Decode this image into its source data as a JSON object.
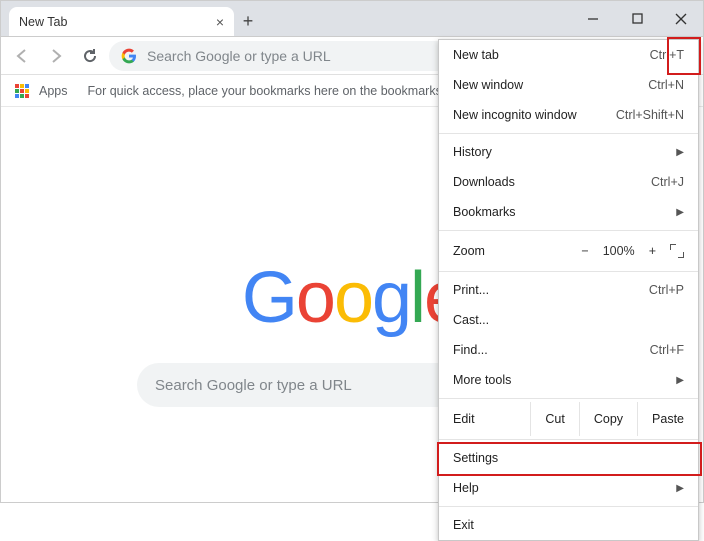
{
  "tab": {
    "title": "New Tab"
  },
  "omnibox": {
    "placeholder": "Search Google or type a URL"
  },
  "bookmarks_bar": {
    "apps_label": "Apps",
    "hint": "For quick access, place your bookmarks here on the bookmarks ba"
  },
  "content": {
    "logo_letters": [
      "G",
      "o",
      "o",
      "g",
      "l",
      "e"
    ],
    "search_placeholder": "Search Google or type a URL"
  },
  "menu": {
    "new_tab": {
      "label": "New tab",
      "shortcut": "Ctrl+T"
    },
    "new_window": {
      "label": "New window",
      "shortcut": "Ctrl+N"
    },
    "new_incognito": {
      "label": "New incognito window",
      "shortcut": "Ctrl+Shift+N"
    },
    "history": {
      "label": "History"
    },
    "downloads": {
      "label": "Downloads",
      "shortcut": "Ctrl+J"
    },
    "bookmarks": {
      "label": "Bookmarks"
    },
    "zoom": {
      "label": "Zoom",
      "value": "100%"
    },
    "print": {
      "label": "Print...",
      "shortcut": "Ctrl+P"
    },
    "cast": {
      "label": "Cast..."
    },
    "find": {
      "label": "Find...",
      "shortcut": "Ctrl+F"
    },
    "more_tools": {
      "label": "More tools"
    },
    "edit": {
      "label": "Edit",
      "cut": "Cut",
      "copy": "Copy",
      "paste": "Paste"
    },
    "settings": {
      "label": "Settings"
    },
    "help": {
      "label": "Help"
    },
    "exit": {
      "label": "Exit"
    }
  }
}
